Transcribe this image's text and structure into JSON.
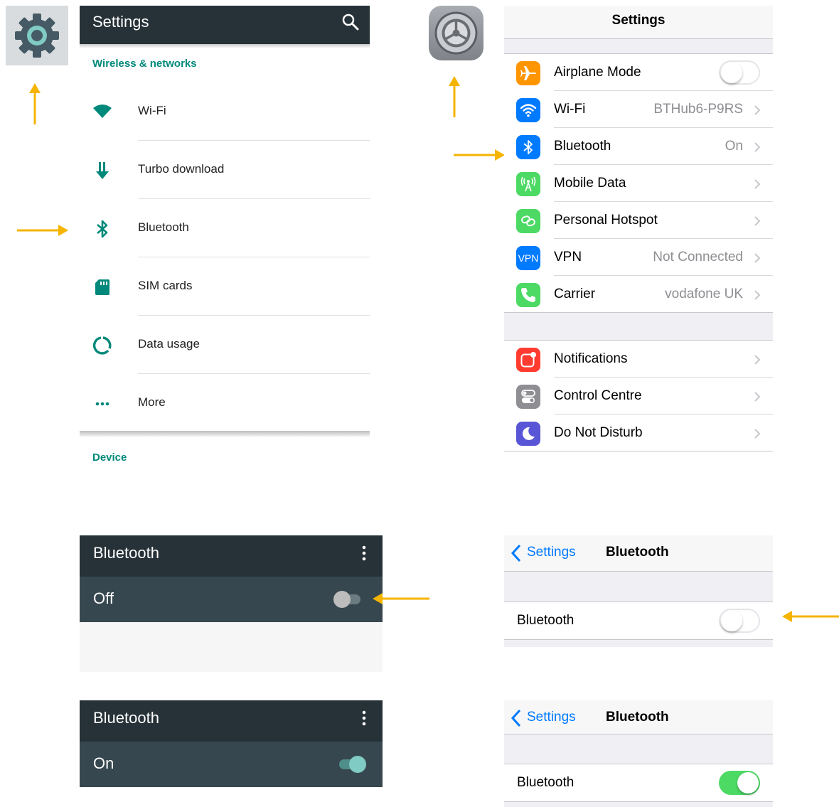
{
  "colors": {
    "arrow": "#f5b400",
    "android_toolbar": "#263238",
    "android_switchbar": "#37474f",
    "android_accent": "#00897b",
    "ios_blue": "#007aff",
    "ios_green": "#4cd964"
  },
  "android_settings": {
    "app_icon": "gear-icon",
    "title": "Settings",
    "search_icon": "search-icon",
    "section_wireless": "Wireless & networks",
    "items": [
      {
        "label": "Wi-Fi",
        "icon": "wifi-icon"
      },
      {
        "label": "Turbo download",
        "icon": "download-arrow-icon"
      },
      {
        "label": "Bluetooth",
        "icon": "bluetooth-icon"
      },
      {
        "label": "SIM cards",
        "icon": "sim-card-icon"
      },
      {
        "label": "Data usage",
        "icon": "data-usage-icon"
      },
      {
        "label": "More",
        "icon": "more-dots-icon"
      }
    ],
    "section_device": "Device"
  },
  "ios_settings": {
    "app_icon": "ios-settings-gear-icon",
    "title": "Settings",
    "group1": [
      {
        "label": "Airplane Mode",
        "value": "",
        "icon": "airplane-icon",
        "color": "#ff9500",
        "toggle": "off"
      },
      {
        "label": "Wi-Fi",
        "value": "BTHub6-P9RS",
        "icon": "wifi-icon",
        "color": "#007aff"
      },
      {
        "label": "Bluetooth",
        "value": "On",
        "icon": "bluetooth-icon",
        "color": "#007aff"
      },
      {
        "label": "Mobile Data",
        "value": "",
        "icon": "antenna-icon",
        "color": "#4cd964"
      },
      {
        "label": "Personal Hotspot",
        "value": "",
        "icon": "hotspot-link-icon",
        "color": "#4cd964"
      },
      {
        "label": "VPN",
        "value": "Not Connected",
        "icon": "vpn-icon",
        "color": "#007aff",
        "badge": "VPN"
      },
      {
        "label": "Carrier",
        "value": "vodafone UK",
        "icon": "phone-icon",
        "color": "#4cd964"
      }
    ],
    "group2": [
      {
        "label": "Notifications",
        "value": "",
        "icon": "notifications-icon",
        "color": "#ff3b30"
      },
      {
        "label": "Control Centre",
        "value": "",
        "icon": "control-centre-icon",
        "color": "#8e8e93"
      },
      {
        "label": "Do Not Disturb",
        "value": "",
        "icon": "moon-icon",
        "color": "#5856d6"
      }
    ]
  },
  "android_bluetooth_off": {
    "title": "Bluetooth",
    "state": "Off",
    "toggle": false
  },
  "android_bluetooth_on": {
    "title": "Bluetooth",
    "state": "On",
    "toggle": true
  },
  "ios_bluetooth_off": {
    "back": "Settings",
    "title": "Bluetooth",
    "row_label": "Bluetooth",
    "toggle": false
  },
  "ios_bluetooth_on": {
    "back": "Settings",
    "title": "Bluetooth",
    "row_label": "Bluetooth",
    "toggle": true
  }
}
